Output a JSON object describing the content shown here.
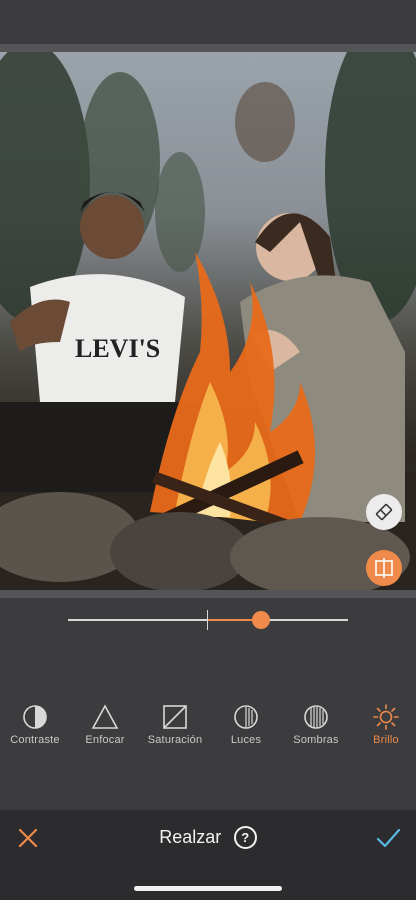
{
  "photo": {
    "description_icon": "campfire-photo"
  },
  "floating_buttons": {
    "eraser_icon": "eraser-icon",
    "compare_icon": "compare-split-icon"
  },
  "slider": {
    "value_fraction": 0.69,
    "center_fraction": 0.5
  },
  "tools": [
    {
      "label": "Contraste",
      "icon": "contrast-icon"
    },
    {
      "label": "Enfocar",
      "icon": "triangle-sharpen-icon"
    },
    {
      "label": "Saturación",
      "icon": "saturation-icon"
    },
    {
      "label": "Luces",
      "icon": "highlights-icon"
    },
    {
      "label": "Sombras",
      "icon": "shadows-icon"
    },
    {
      "label": "Brillo",
      "icon": "sun-brightness-icon",
      "active": true
    }
  ],
  "bottom_bar": {
    "title": "Realzar",
    "help_label": "?",
    "cancel_icon": "close-icon",
    "confirm_icon": "checkmark-icon"
  },
  "colors": {
    "accent": "#ef8a4a",
    "confirm": "#5ab8e8",
    "background": "#3c3c3e"
  }
}
